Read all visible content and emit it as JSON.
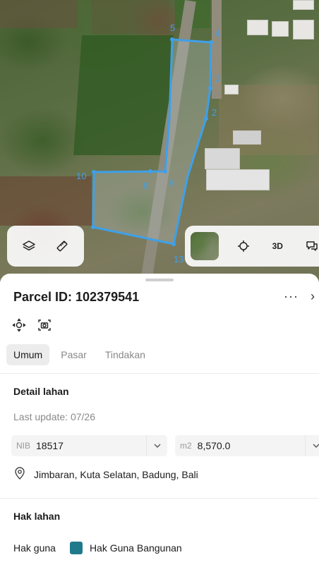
{
  "map": {
    "point_labels": [
      "1",
      "2",
      "3",
      "4",
      "5",
      "8",
      "9",
      "10",
      "13"
    ],
    "parcel_color": "#3fa0e8",
    "controls": {
      "layers_icon": "layers-icon",
      "measure_icon": "ruler-icon",
      "basemap_icon": "satellite-thumbnail",
      "locate_icon": "crosshair-icon",
      "three_d_label": "3D",
      "chat_icon": "chat-icon"
    }
  },
  "sheet": {
    "title": "Parcel ID: 102379541",
    "more_label": "···",
    "close_label": "›",
    "tabs": [
      {
        "label": "Umum",
        "active": true
      },
      {
        "label": "Pasar",
        "active": false
      },
      {
        "label": "Tindakan",
        "active": false
      }
    ],
    "detail": {
      "heading": "Detail lahan",
      "last_update": "Last update: 07/26",
      "nib_prefix": "NIB",
      "nib_value": "18517",
      "area_prefix": "m2",
      "area_value": "8,570.0",
      "location": "Jimbaran, Kuta Selatan, Badung, Bali"
    },
    "rights": {
      "heading": "Hak lahan",
      "label": "Hak guna",
      "value": "Hak Guna Bangunan",
      "color": "#1f7a8c"
    }
  }
}
